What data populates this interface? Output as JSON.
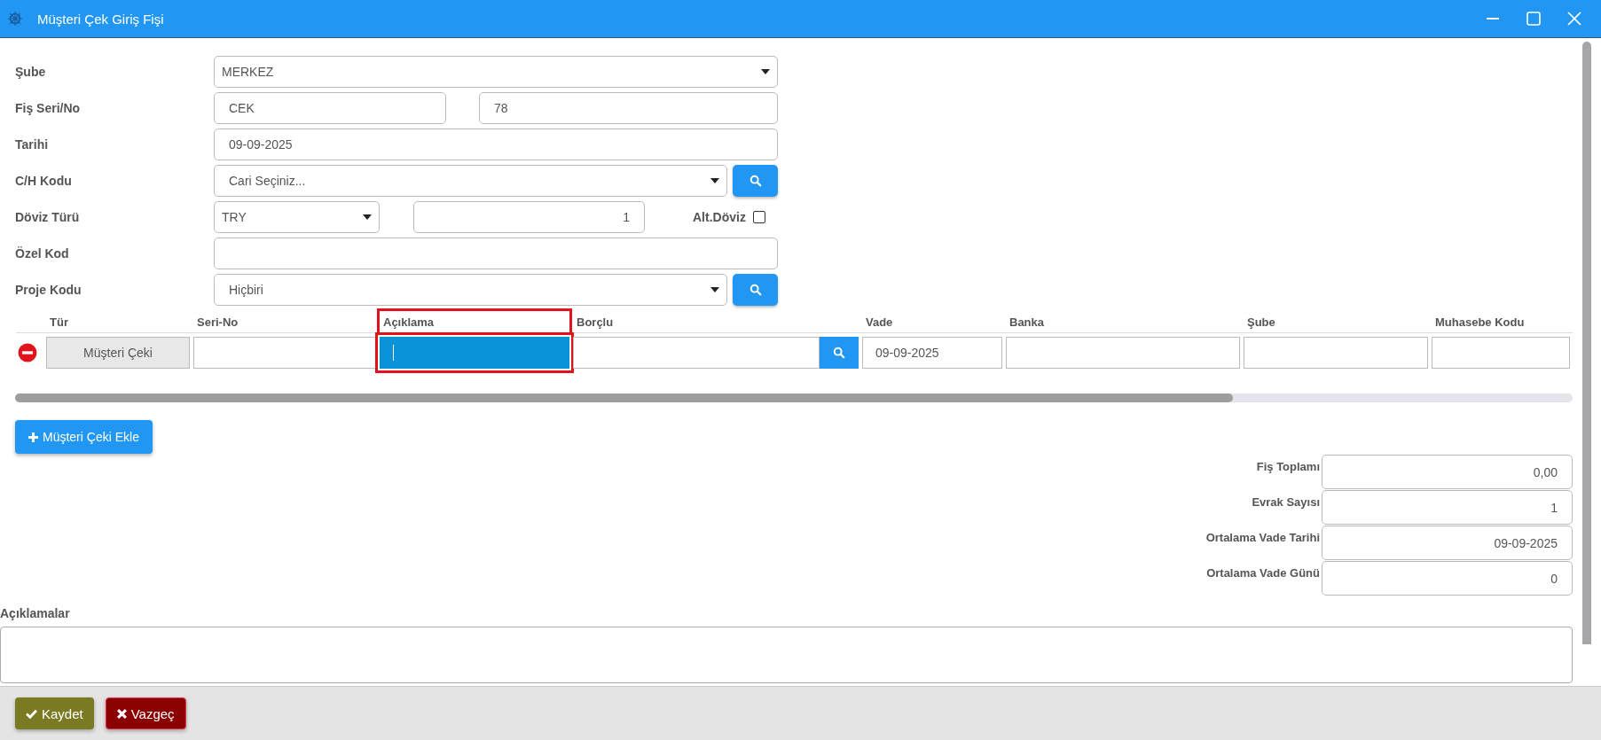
{
  "window": {
    "title": "Müşteri Çek Giriş Fişi"
  },
  "form": {
    "sube": {
      "label": "Şube",
      "value": "MERKEZ"
    },
    "fis_seri_no": {
      "label": "Fiş Seri/No",
      "seri": "CEK",
      "no": "78"
    },
    "tarihi": {
      "label": "Tarihi",
      "value": "09-09-2025"
    },
    "ch_kodu": {
      "label": "C/H Kodu",
      "value": "Cari Seçiniz..."
    },
    "doviz_turu": {
      "label": "Döviz Türü",
      "value": "TRY",
      "rate": "1",
      "alt_label": "Alt.Döviz",
      "alt_checked": false
    },
    "ozel_kod": {
      "label": "Özel Kod"
    },
    "proje_kodu": {
      "label": "Proje Kodu",
      "value": "Hiçbiri"
    }
  },
  "grid": {
    "columns": [
      {
        "label": "Tür",
        "highlighted": false
      },
      {
        "label": "Seri-No",
        "highlighted": false
      },
      {
        "label": "Açıklama",
        "highlighted": true
      },
      {
        "label": "Borçlu",
        "highlighted": false
      },
      {
        "label": "Vade",
        "highlighted": false
      },
      {
        "label": "Banka",
        "highlighted": false
      },
      {
        "label": "Şube",
        "highlighted": false
      },
      {
        "label": "Muhasebe Kodu",
        "highlighted": false
      }
    ],
    "rows": [
      {
        "cells": [
          {
            "kind": "readonly",
            "value": "Müşteri Çeki"
          },
          {
            "kind": "input"
          },
          {
            "kind": "input",
            "focused": true
          },
          {
            "kind": "lookup"
          },
          {
            "kind": "input",
            "value": "09-09-2025"
          },
          {
            "kind": "input"
          },
          {
            "kind": "input"
          },
          {
            "kind": "input"
          }
        ]
      }
    ]
  },
  "add_button": "Müşteri Çeki Ekle",
  "summary": [
    {
      "label": "Fiş Toplamı",
      "value": "0,00"
    },
    {
      "label": "Evrak Sayısı",
      "value": "1"
    },
    {
      "label": "Ortalama Vade Tarihi",
      "value": "09-09-2025"
    },
    {
      "label": "Ortalama Vade Günü",
      "value": "0"
    }
  ],
  "notes": {
    "label": "Açıklamalar"
  },
  "footer": {
    "save": "Kaydet",
    "cancel": "Vazgeç"
  }
}
